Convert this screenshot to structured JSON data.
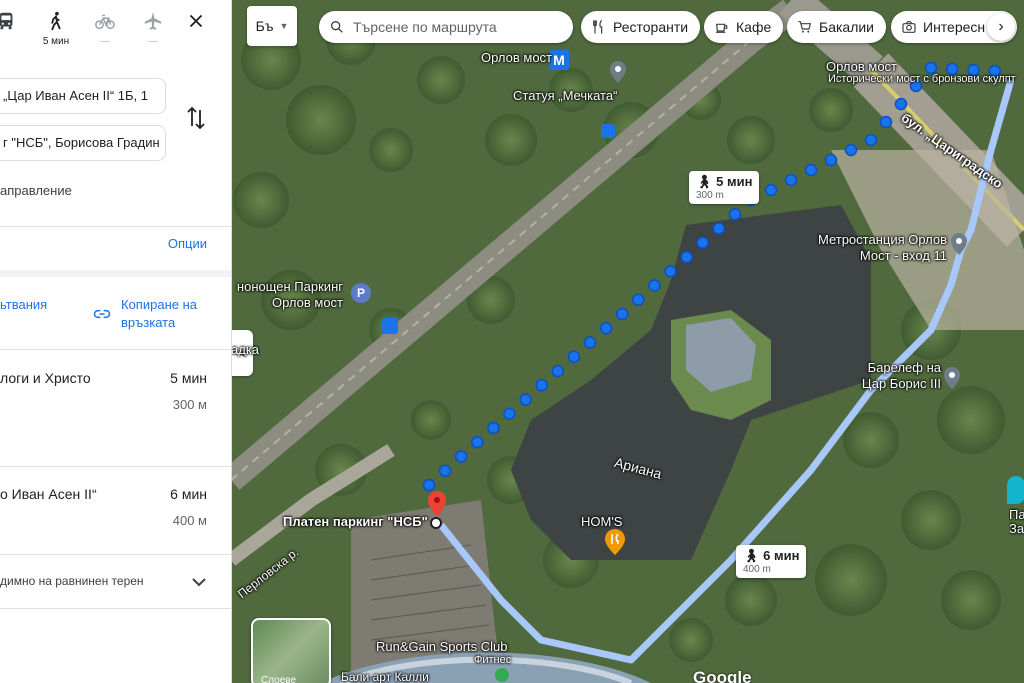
{
  "panel": {
    "modes": [
      {
        "name": "transit",
        "label": ""
      },
      {
        "name": "walk",
        "label": "5 мин"
      },
      {
        "name": "bicycle",
        "label": "—"
      },
      {
        "name": "flight",
        "label": "—"
      }
    ],
    "origin_value": "„Цар Иван Асен II“ 1Б, 1",
    "destination_value": "г \"НСБ\", Борисова Градин",
    "add_destination": "аправление",
    "options_label": "Опции",
    "send_directions": "ьтвания",
    "copy_link": "Копиране на връзката",
    "routes": [
      {
        "name": "логи и Христо",
        "time": "5 мин",
        "distance": "300 м"
      },
      {
        "name": "о Иван Асен II“",
        "time": "6 мин",
        "distance": "400 м"
      }
    ],
    "terrain_note": "димно на равнинен терен"
  },
  "map": {
    "lang_button": "Бъ",
    "search_placeholder": "Търсене по маршрута",
    "chips": [
      "Ресторанти",
      "Кафе",
      "Бакалии",
      "Интересн"
    ],
    "labels": {
      "orlov_most": "Орлов мост",
      "orlov_most_2": "Орлов мост",
      "orlov_desc": "Исторически мост с бронзови скулпт",
      "statue": "Статуя „Мечката“",
      "bulevard": "бул. „Цариградско",
      "metro": "Метростанция Орлов Мост - вход 11",
      "parking_night": "нонощен Паркинг Орлов мост",
      "gradka": "адка",
      "barelef": "Барелеф на Цар Борис III",
      "ariana": "Ариана",
      "homs": "HOM'S",
      "platen_parking": "Платен паркинг \"НСБ\"",
      "perlovska": "Перловска р.",
      "rungain": "Run&Gain Sports Club",
      "fitnes": "Фитнес",
      "bali": "Бали арт Калли",
      "pa_za": "Па За"
    },
    "walk_callout_1": {
      "time": "5 мин",
      "dist": "300 m"
    },
    "walk_callout_2": {
      "time": "6 мин",
      "dist": "400 m"
    },
    "layer_label": "Слоеве",
    "google": "Google"
  },
  "colors": {
    "route_blue": "#1a73e8",
    "route_alt": "#a8c7fa",
    "accent": "#1a73e8"
  }
}
